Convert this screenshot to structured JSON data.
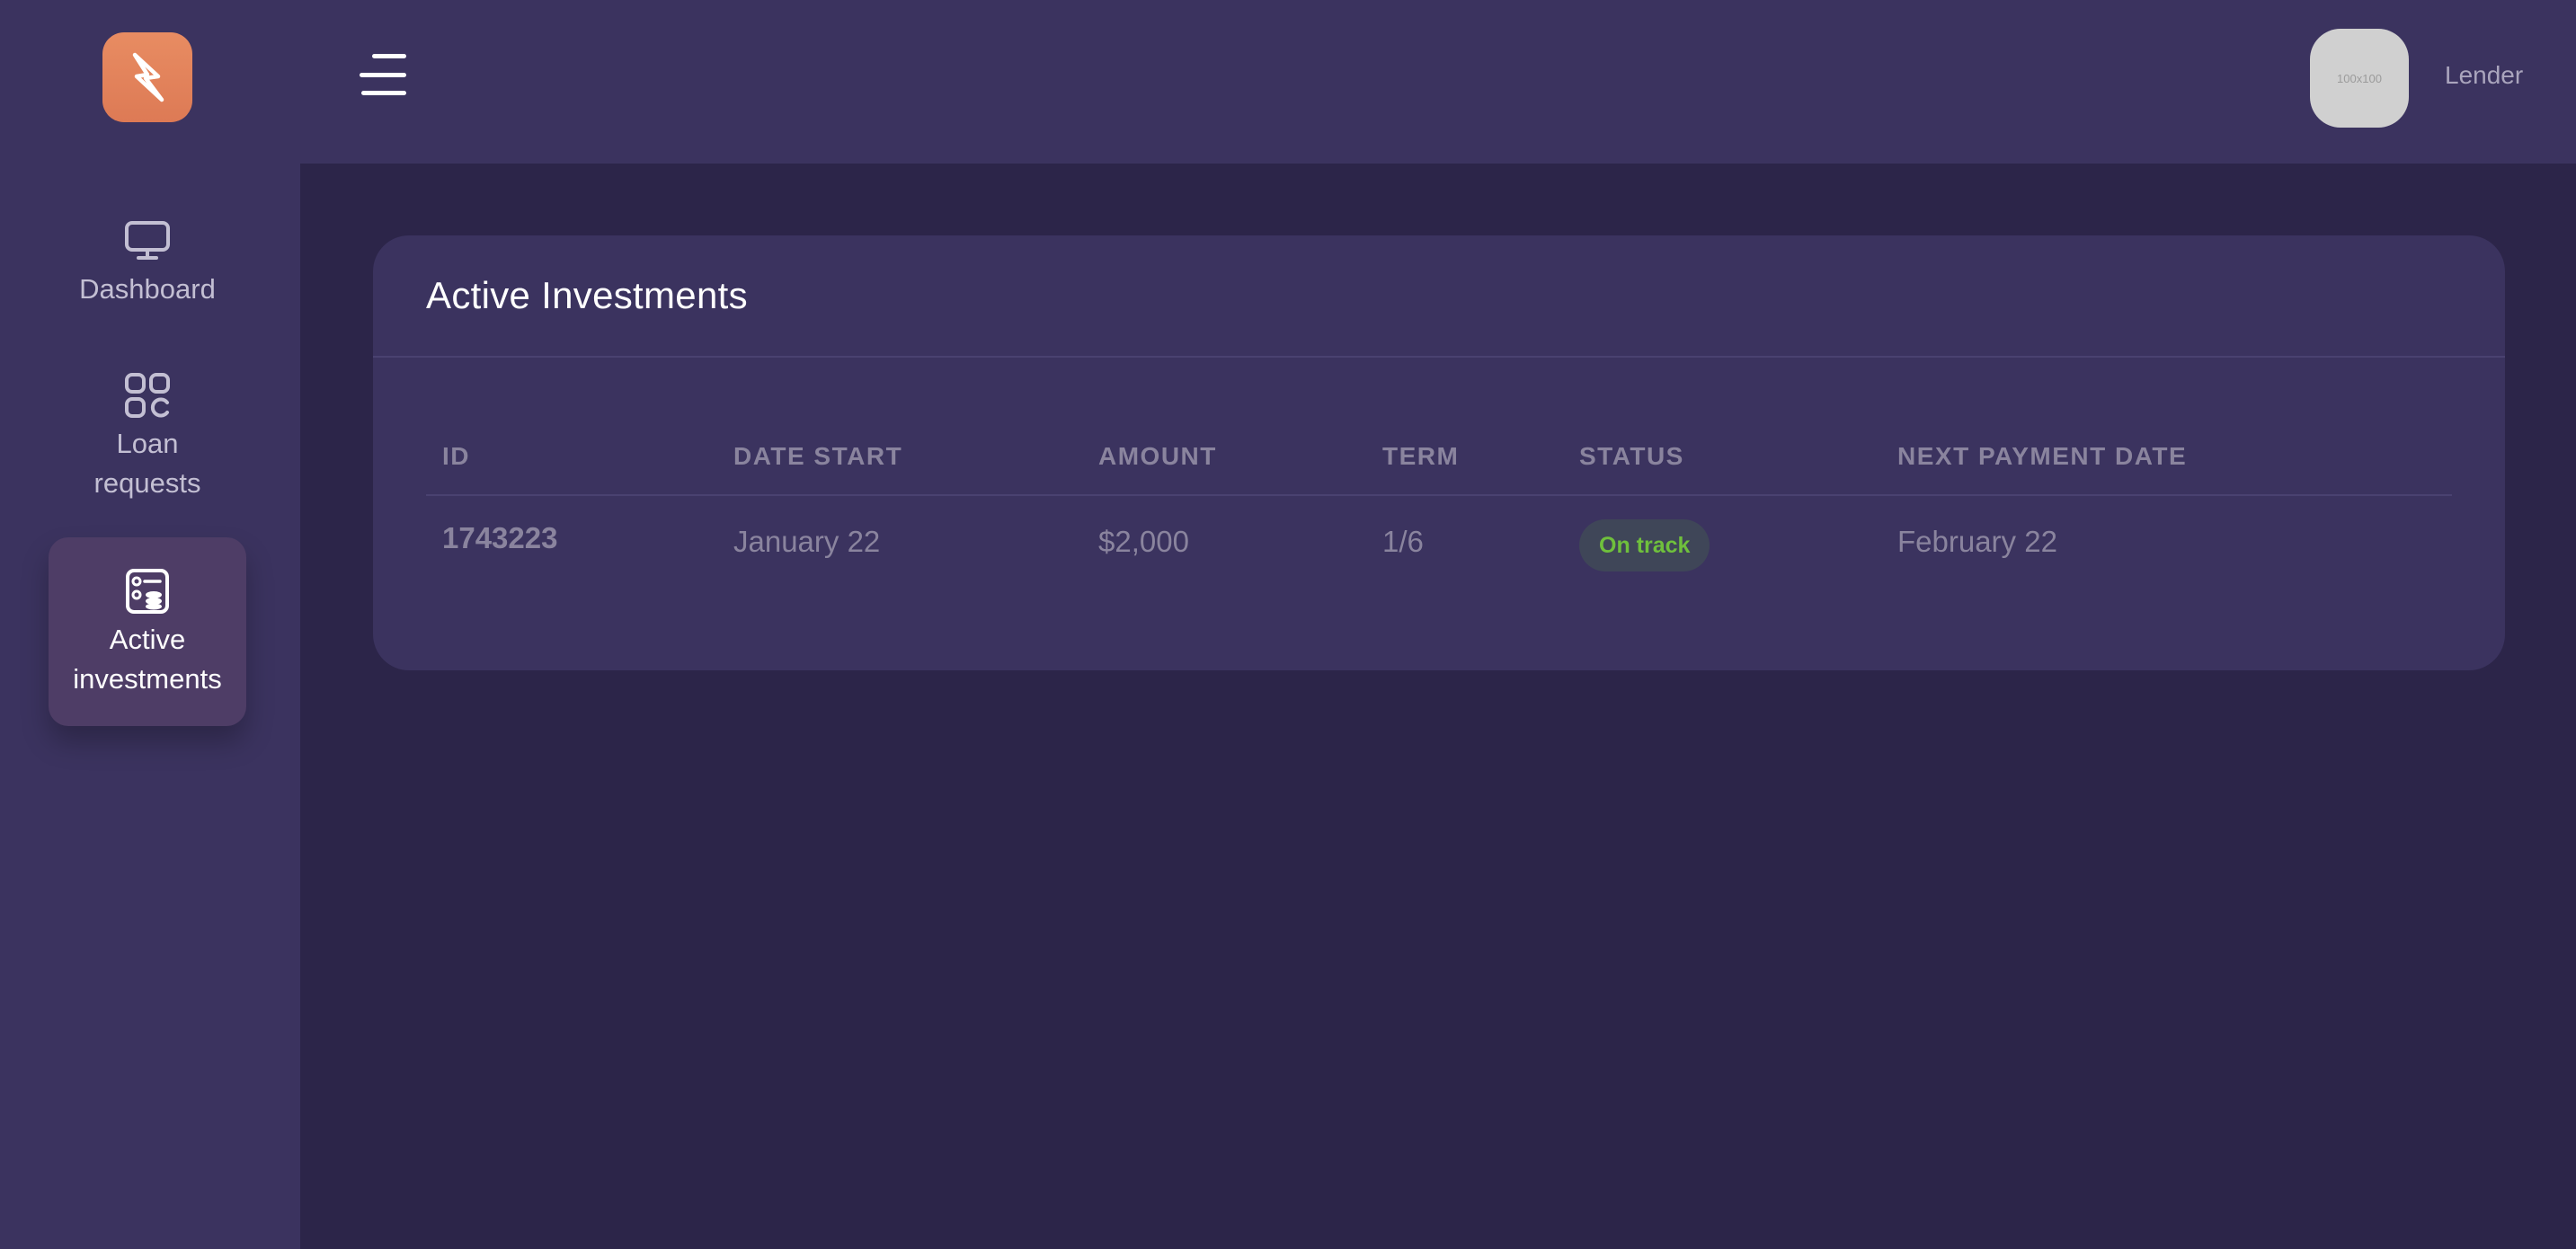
{
  "sidebar": {
    "items": [
      {
        "label": "Dashboard",
        "icon": "monitor-icon"
      },
      {
        "label": "Loan\nrequests",
        "icon": "grid-icon"
      },
      {
        "label": "Active\ninvestments",
        "icon": "investments-icon",
        "active": true
      }
    ]
  },
  "header": {
    "avatar_text": "100x100",
    "user_role": "Lender"
  },
  "main": {
    "title": "Active Investments",
    "table": {
      "columns": [
        "ID",
        "DATE START",
        "AMOUNT",
        "TERM",
        "STATUS",
        "NEXT PAYMENT DATE"
      ],
      "rows": [
        {
          "id": "1743223",
          "date_start": "January 22",
          "amount": "$2,000",
          "term": "1/6",
          "status": "On track",
          "next_payment": "February 22"
        }
      ]
    }
  },
  "colors": {
    "accent": "#e2845b",
    "background": "#2c2549",
    "panel": "#3b335f",
    "status_ok": "#6fc03c"
  }
}
